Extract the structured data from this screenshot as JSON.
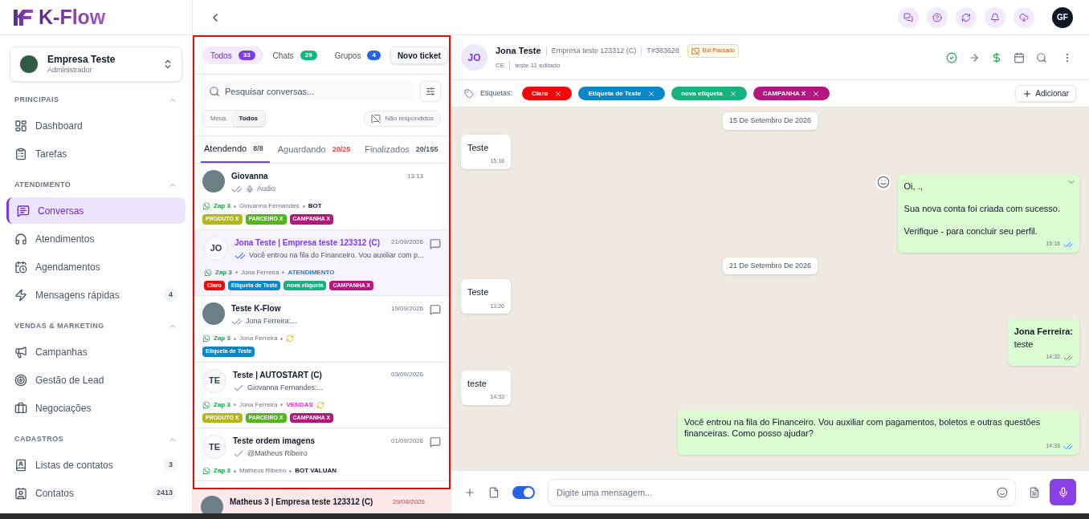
{
  "brand": {
    "name": "K-Flow"
  },
  "account": {
    "name": "Empresa Teste",
    "role": "Administrador"
  },
  "sidebar": {
    "sections": [
      {
        "title": "PRINCIPAIS",
        "expanded": true,
        "items": [
          {
            "label": "Dashboard",
            "selected": false
          },
          {
            "label": "Tarefas",
            "selected": false
          }
        ]
      },
      {
        "title": "ATENDIMENTO",
        "expanded": true,
        "items": [
          {
            "label": "Conversas",
            "selected": true
          },
          {
            "label": "Atendimentos",
            "selected": false
          },
          {
            "label": "Agendamentos",
            "selected": false
          },
          {
            "label": "Mensagens rápidas",
            "selected": false,
            "badge": "4"
          }
        ]
      },
      {
        "title": "VENDAS & MARKETING",
        "expanded": true,
        "items": [
          {
            "label": "Campanhas",
            "selected": false
          },
          {
            "label": "Gestão de Lead",
            "selected": false
          },
          {
            "label": "Negociações",
            "selected": false
          }
        ]
      },
      {
        "title": "CADASTROS",
        "expanded": true,
        "items": [
          {
            "label": "Listas de contatos",
            "selected": false,
            "badge": "3"
          },
          {
            "label": "Contatos",
            "selected": false,
            "badge": "2413"
          }
        ]
      }
    ]
  },
  "topbar": {
    "user_initials": "GF"
  },
  "conversation_list": {
    "filter_tabs": [
      {
        "label": "Todos",
        "count": "33",
        "color": "#7c3aed",
        "selected": true
      },
      {
        "label": "Chats",
        "count": "29",
        "color": "#10b981",
        "selected": false
      },
      {
        "label": "Grupos",
        "count": "4",
        "color": "#2563eb",
        "selected": false
      }
    ],
    "new_ticket_button": "Novo ticket",
    "search": {
      "placeholder": "Pesquisar conversas..."
    },
    "owner_filter": [
      {
        "label": "Meus",
        "selected": false
      },
      {
        "label": "Todos",
        "selected": true
      }
    ],
    "unanswered_button": "Não respondidos",
    "status_tabs": [
      {
        "label": "Atendendo",
        "count": "8/8",
        "color": "#4b5563",
        "selected": true
      },
      {
        "label": "Aguardando",
        "count": "20/25",
        "color": "#ef4444",
        "selected": false
      },
      {
        "label": "Finalizados",
        "count": "20/155",
        "color": "#4b5563",
        "selected": false
      }
    ],
    "conversations": [
      {
        "name": "Giovanna",
        "time": "13:13",
        "photo": true,
        "receipt": {
          "kind": "double",
          "read": false
        },
        "audio": true,
        "preview": "Áudio",
        "connection": "Zap 3",
        "agent": "Giovanna Fernandes",
        "queue": {
          "label": "BOT",
          "color": "#111827"
        },
        "selected": false,
        "tags": [
          {
            "label": "PRODUTO X",
            "color": "#b3b815"
          },
          {
            "label": "PARCEIRO X",
            "color": "#52b71d"
          },
          {
            "label": "CAMPANHA X",
            "color": "#b4177b"
          }
        ]
      },
      {
        "name": "Jona Teste | Empresa teste 123312 (C)",
        "time": "21/09/2026",
        "initials": "JO",
        "receipt": {
          "kind": "double",
          "read": true
        },
        "preview": "Você entrou na fila do Financeiro. Vou auxiliar com p...",
        "connection": "Zap 3",
        "agent": "Jona Ferreira",
        "queue": {
          "label": "ATENDIMENTO",
          "color": "#2b7bbf"
        },
        "comment": true,
        "selected": true,
        "tags": [
          {
            "label": "Claro",
            "color": "#ee0a0a"
          },
          {
            "label": "Etiqueta de Teste",
            "color": "#0b86c6"
          },
          {
            "label": "nova etiqueta",
            "color": "#17b07f"
          },
          {
            "label": "CAMPANHA X",
            "color": "#b4177b"
          }
        ]
      },
      {
        "name": "Teste K-Flow",
        "time": "19/09/2026",
        "photo": true,
        "receipt": {
          "kind": "double",
          "read": false
        },
        "preview": "Jona Ferreira:...",
        "connection": "Zap 3",
        "agent": "Jona Ferreira",
        "syncing": true,
        "comment": true,
        "selected": false,
        "tags": [
          {
            "label": "Etiqueta de Teste",
            "color": "#0b86c6"
          }
        ]
      },
      {
        "name": "Teste | AUTOSTART (C)",
        "time": "03/09/2026",
        "initials": "TE",
        "receipt": {
          "kind": "single",
          "read": false
        },
        "preview": "Giovanna Fernandes:...",
        "connection": "Zap 3",
        "agent": "Jona Ferreira",
        "queue": {
          "label": "VENDAS",
          "color": "#d63bc5"
        },
        "syncing": true,
        "selected": false,
        "tags": [
          {
            "label": "PRODUTO X",
            "color": "#b3b815"
          },
          {
            "label": "PARCEIRO X",
            "color": "#52b71d"
          },
          {
            "label": "CAMPANHA X",
            "color": "#b4177b"
          }
        ]
      },
      {
        "name": "Teste ordem imagens",
        "time": "01/09/2026",
        "initials": "TE",
        "receipt": {
          "kind": "single",
          "read": false
        },
        "preview": "@Matheus Ribeiro",
        "connection": "Zap 3",
        "agent": "Matheus Ribeiro",
        "queue": {
          "label": "BOT VALUAN",
          "color": "#111827"
        },
        "comment": true,
        "selected": false
      },
      {
        "name": "Matheus 3 | Empresa teste 123312 (C)",
        "time": "29/08/2026",
        "photo": true,
        "selected": false,
        "late": true
      }
    ]
  },
  "chat": {
    "contact": {
      "initials": "JO",
      "name": "Jona Teste",
      "company": "Empresa teste 123312 (C)",
      "ticket": "T#383628",
      "bot_status": "Bot Pausado",
      "state": "CE",
      "note": "teste 11 editado"
    },
    "tags_label": "Etiquetas:",
    "tags": [
      {
        "label": "Claro",
        "color": "#ee0a0a"
      },
      {
        "label": "Etiqueta de Teste",
        "color": "#0b86c6"
      },
      {
        "label": "nova etiqueta",
        "color": "#17b07f"
      },
      {
        "label": "CAMPANHA X",
        "color": "#b4177b"
      }
    ],
    "add_tag_button": "Adicionar",
    "messages": [
      {
        "kind": "date",
        "text": "15 De Setembro De 2026"
      },
      {
        "kind": "incoming",
        "text": "Teste",
        "time": "15:18"
      },
      {
        "kind": "outgoing",
        "text": "Oi, .,\n\nSua nova conta foi criada com sucesso.\n\nVerifique - para concluir seu perfil.",
        "time": "15:18",
        "hovered": true
      },
      {
        "kind": "date",
        "text": "21 De Setembro De 2026"
      },
      {
        "kind": "incoming",
        "text": "Teste",
        "time": "13:26"
      },
      {
        "kind": "outgoing",
        "sender": "Jona Ferreira:",
        "text": "teste",
        "time": "14:32",
        "hovered": false
      },
      {
        "kind": "incoming",
        "text": "teste",
        "time": "14:33"
      },
      {
        "kind": "outgoing",
        "text": "Você entrou na fila do Financeiro. Vou auxiliar com pagamentos, boletos e outras questões financeiras. Como posso ajudar?",
        "time": "14:33",
        "hovered": false
      }
    ],
    "composer": {
      "signature_on": true,
      "placeholder": "Digite uma mensagem..."
    }
  }
}
